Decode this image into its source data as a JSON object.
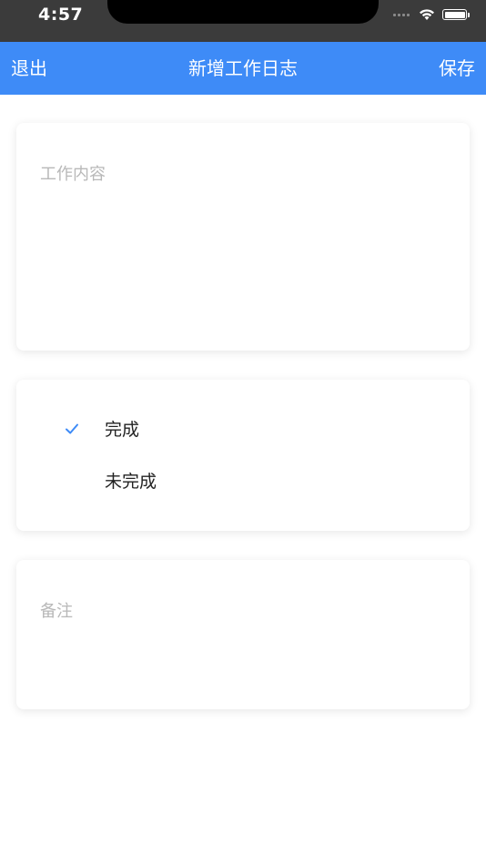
{
  "status_bar": {
    "time": "4:57"
  },
  "navbar": {
    "left_label": "退出",
    "title": "新增工作日志",
    "right_label": "保存"
  },
  "work_content": {
    "placeholder": "工作内容",
    "value": ""
  },
  "status_options": [
    {
      "label": "完成",
      "selected": true
    },
    {
      "label": "未完成",
      "selected": false
    }
  ],
  "notes": {
    "placeholder": "备注",
    "value": ""
  },
  "colors": {
    "accent": "#3e8bf7",
    "status_bar_bg": "#3b3b3b",
    "placeholder": "#b8b8b8"
  },
  "icons": {
    "selected_marker": "checkmark-icon",
    "wifi": "wifi-icon",
    "battery": "battery-icon"
  }
}
